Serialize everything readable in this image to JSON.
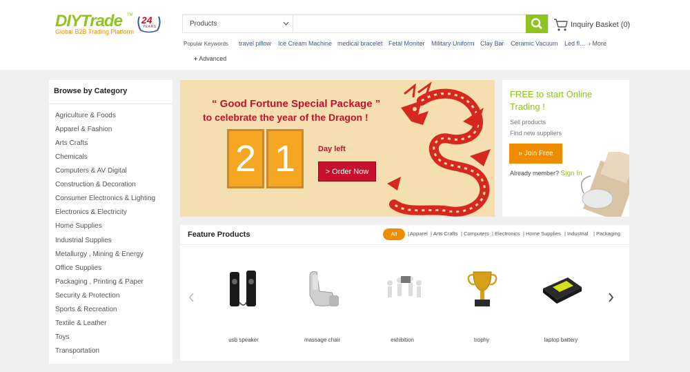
{
  "brand": {
    "logo_diy": "DIY",
    "logo_trade": "Trade",
    "logo_tm": "TM",
    "logo_sub": "Global B2B Trading Platform",
    "badge_number": "24",
    "badge_text": "YEARS",
    "brand_color": "#8fc31f",
    "accent_color": "#f08c00"
  },
  "search": {
    "category_value": "Products",
    "input_value": "",
    "button_icon": "search-icon"
  },
  "basket": {
    "label": "Inquiry Basket (0)"
  },
  "keywords": {
    "title": "Popular Keywords",
    "items": [
      "travel pillow",
      "Ice Cream Machine",
      "medical bracelet",
      "Fetal Moniter",
      "Military Uniform",
      "Clay Bar",
      "Ceramic Vacuum",
      "Led fl..."
    ],
    "more": "More",
    "advanced": "Advanced"
  },
  "sidebar": {
    "title": "Browse by Category",
    "items": [
      "Agriculture & Foods",
      "Apparel & Fashion",
      "Arts Crafts",
      "Chemicals",
      "Computers & AV Digital",
      "Construction & Decoration",
      "Consumer Electronics & Lighting",
      "Electronics & Electricity",
      "Home Supplies",
      "Industrial Supplies",
      "Metallurgy , Mining & Energy",
      "Office Supplies",
      "Packaging , Printing & Paper",
      "Security & Protection",
      "Sports & Recreation",
      "Textile & Leather",
      "Toys",
      "Transportation"
    ]
  },
  "banner": {
    "line1": "“ Good Fortune Special Package ”",
    "line2": "to celebrate the year of the Dragon !",
    "digit1": "2",
    "digit2": "1",
    "day_left": "Day left",
    "order_button": "> Order Now"
  },
  "freebox": {
    "title": "FREE to start Online Trading !",
    "items": [
      "Sell products",
      "Find new suppliers"
    ],
    "join_button": "» Join Free",
    "member_text": "Already member?",
    "sign_in": "Sign In"
  },
  "feature": {
    "title": "Feature Products",
    "tab_all": "All",
    "tabs": [
      "Apparel",
      "Arts Crafts",
      "Computers",
      "Electronics",
      "Home Supplies",
      "Industrial",
      "Packaging"
    ],
    "products": [
      "usb speaker",
      "massage chair",
      "exhibition",
      "trophy",
      "laptop battery"
    ]
  }
}
